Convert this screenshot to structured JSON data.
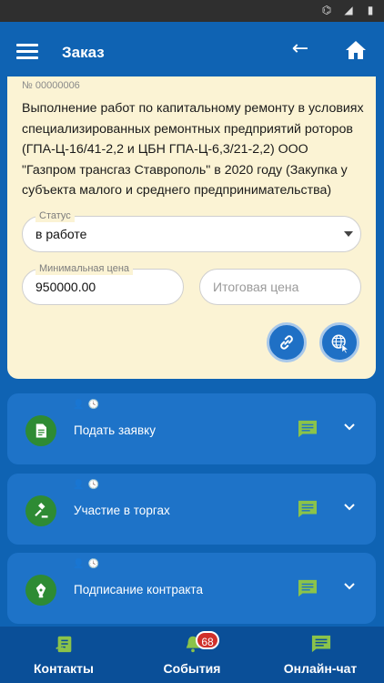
{
  "header": {
    "title": "Заказ"
  },
  "order": {
    "number": "№ 00000006",
    "title": "Выполнение работ по капитальному ремонту в условиях специализированных ремонтных предприятий роторов (ГПА-Ц-16/41-2,2 и ЦБН ГПА-Ц-6,3/21-2,2) ООО \"Газпром трансгаз Ставрополь\" в 2020 году (Закупка у субъекта малого и среднего предпринимательства)"
  },
  "status": {
    "label": "Статус",
    "value": "в работе"
  },
  "min_price": {
    "label": "Минимальная цена",
    "value": "950000.00"
  },
  "final_price": {
    "placeholder": "Итоговая цена"
  },
  "stages": [
    {
      "label": "Подать заявку",
      "icon": "document-icon"
    },
    {
      "label": "Участие в торгах",
      "icon": "gavel-icon"
    },
    {
      "label": "Подписание контракта",
      "icon": "pen-nib-icon"
    }
  ],
  "bottom_nav": {
    "contacts": "Контакты",
    "events": "События",
    "events_badge": "68",
    "chat": "Онлайн-чат"
  },
  "colors": {
    "primary": "#0f63b3",
    "card": "#fbf3d4",
    "stage": "#1e73c8",
    "accent_green": "#8bc34a",
    "badge": "#d0302b"
  }
}
